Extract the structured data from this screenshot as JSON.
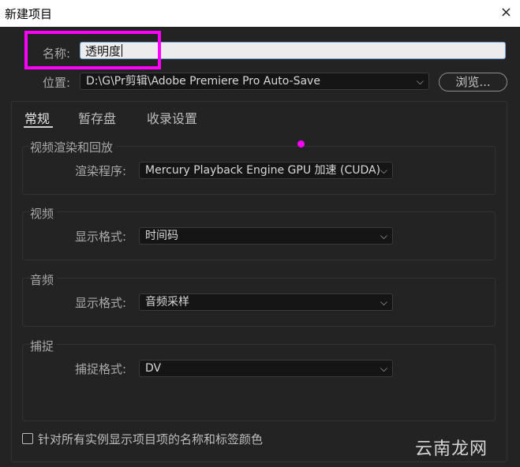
{
  "window": {
    "title": "新建项目",
    "close_icon": "×"
  },
  "name": {
    "label": "名称:",
    "value": "透明度"
  },
  "location": {
    "label": "位置:",
    "value": "D:\\G\\Pr剪辑\\Adobe Premiere Pro Auto-Save",
    "browse_label": "浏览..."
  },
  "tabs": [
    {
      "label": "常规",
      "active": true
    },
    {
      "label": "暂存盘"
    },
    {
      "label": "收录设置"
    }
  ],
  "groups": {
    "render": {
      "title": "视频渲染和回放",
      "field_label": "渲染程序:",
      "value": "Mercury Playback Engine GPU 加速 (CUDA)"
    },
    "video": {
      "title": "视频",
      "field_label": "显示格式:",
      "value": "时间码"
    },
    "audio": {
      "title": "音频",
      "field_label": "显示格式:",
      "value": "音频采样"
    },
    "capture": {
      "title": "捕捉",
      "field_label": "捕捉格式:",
      "value": "DV"
    }
  },
  "checkbox": {
    "label": "针对所有实例显示项目项的名称和标签颜色",
    "checked": false
  },
  "watermark": "云南龙网",
  "colors": {
    "highlight": "#ff00ff",
    "input_focus": "#6d9fd6"
  }
}
